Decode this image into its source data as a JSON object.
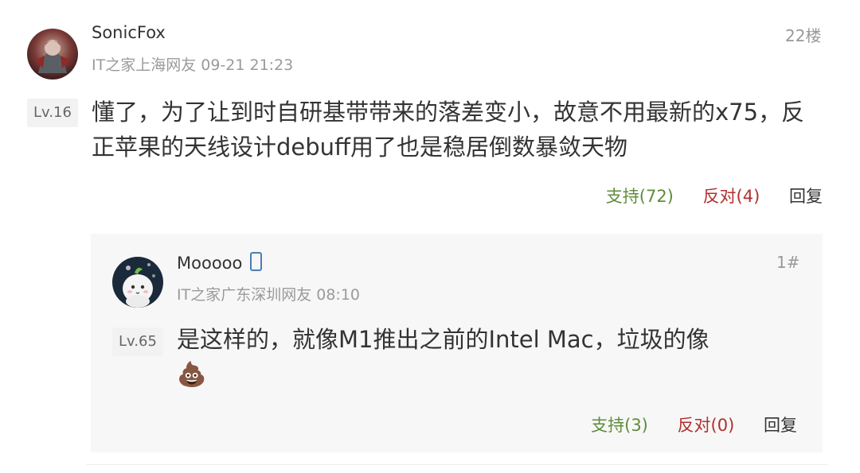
{
  "comment": {
    "username": "SonicFox",
    "meta": "IT之家上海网友 09-21 21:23",
    "floor": "22楼",
    "level": "Lv.16",
    "content": "懂了，为了让到时自研基带带来的落差变小，故意不用最新的x75，反正苹果的天线设计debuff用了也是稳居倒数暴敛天物",
    "actions": {
      "support": "支持(72)",
      "oppose": "反对(4)",
      "reply": "回复"
    }
  },
  "reply": {
    "username": "Mooooo",
    "device_icon": "phone-icon",
    "meta": "IT之家广东深圳网友 08:10",
    "floor": "1#",
    "level": "Lv.65",
    "content": "是这样的，就像M1推出之前的Intel Mac，垃圾的像",
    "emoji": "💩",
    "actions": {
      "support": "支持(3)",
      "oppose": "反对(0)",
      "reply": "回复"
    }
  },
  "colors": {
    "support": "#5f8c3a",
    "oppose": "#b22f2f",
    "meta": "#9a9a9a",
    "reply_bg": "#f7f7f7"
  }
}
